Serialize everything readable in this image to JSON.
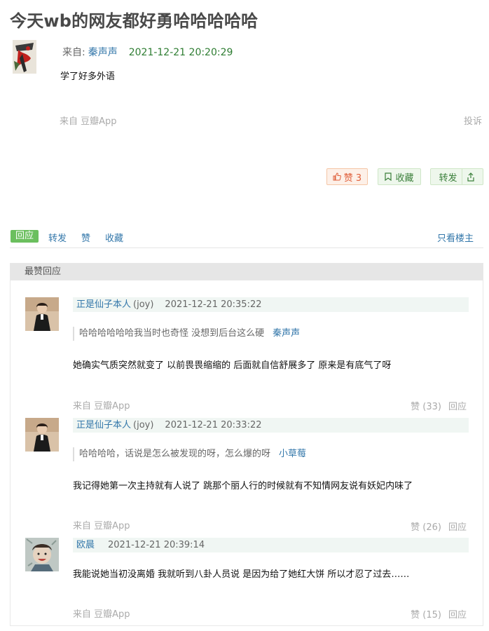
{
  "post": {
    "title": "今天wb的网友都好勇哈哈哈哈哈",
    "from_label": "来自:",
    "author": "秦声声",
    "time": "2021-12-21 20:20:29",
    "body": "学了好多外语",
    "source": "来自 豆瓣App",
    "report": "投诉",
    "like_label": "赞 3",
    "fav_label": "收藏",
    "share_label": "转发"
  },
  "tabs": {
    "reply": "回应",
    "repost": "转发",
    "like": "赞",
    "fav": "收藏",
    "only_op": "只看楼主"
  },
  "panel": {
    "heading": "最赞回应"
  },
  "comments": [
    {
      "name": "正是仙子本人",
      "tag": "(joy)",
      "time": "2021-12-21 20:35:22",
      "quote": "哈哈哈哈哈哈我当时也奇怪 没想到后台这么硬",
      "quote_author": "秦声声",
      "text": "她确实气质突然就变了 以前畏畏缩缩的 后面就自信舒展多了 原来是有底气了呀",
      "source": "来自 豆瓣App",
      "likes": "赞 (33)",
      "reply": "回应"
    },
    {
      "name": "正是仙子本人",
      "tag": "(joy)",
      "time": "2021-12-21 20:33:22",
      "quote": "哈哈哈哈，话说是怎么被发现的呀，怎么爆的呀",
      "quote_author": "小草莓",
      "text": "我记得她第一次主持就有人说了 跳那个丽人行的时候就有不知情网友说有妖妃内味了",
      "source": "来自 豆瓣App",
      "likes": "赞 (26)",
      "reply": "回应"
    },
    {
      "name": "欧晨",
      "tag": "",
      "time": "2021-12-21 20:39:14",
      "text": "我能说她当初没离婚 我就听到八卦人员说 是因为给了她红大饼 所以才忍了过去……",
      "source": "来自 豆瓣App",
      "likes": "赞 (15)",
      "reply": "回应"
    }
  ]
}
